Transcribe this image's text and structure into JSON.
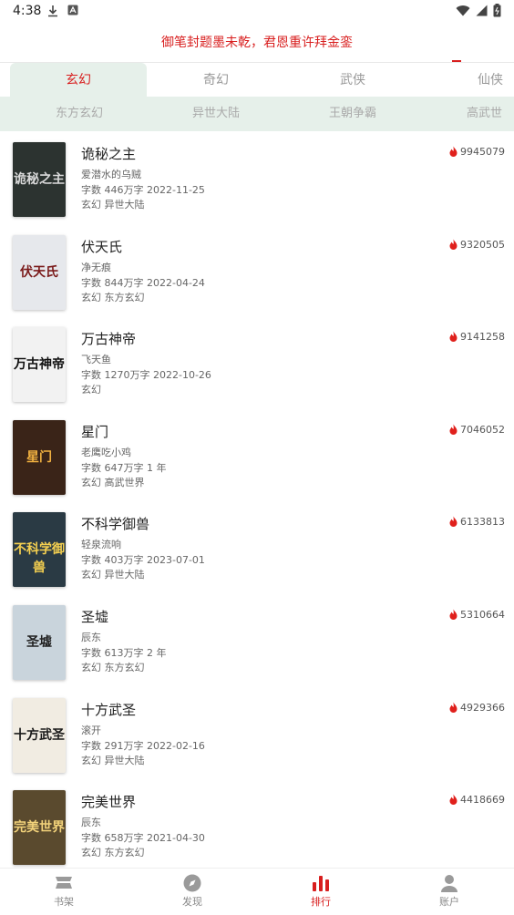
{
  "status_bar": {
    "time": "4:38"
  },
  "header": {
    "slogan": "御笔封题墨未乾，君恩重许拜金銮"
  },
  "tabs": [
    {
      "label": "玄幻",
      "active": true
    },
    {
      "label": "奇幻",
      "active": false
    },
    {
      "label": "武侠",
      "active": false
    },
    {
      "label": "仙侠",
      "active": false
    }
  ],
  "subtabs": [
    {
      "label": "东方玄幻"
    },
    {
      "label": "异世大陆"
    },
    {
      "label": "王朝争霸"
    },
    {
      "label": "高武世"
    }
  ],
  "books": [
    {
      "title": "诡秘之主",
      "author": "爱潜水的乌贼",
      "stats": "字数 446万字  2022-11-25",
      "tags": "玄幻 异世大陆",
      "heat": "9945079",
      "cover_text": "诡秘之主",
      "cover_bg": "#2c3330",
      "cover_fg": "#d9d9d9"
    },
    {
      "title": "伏天氏",
      "author": "净无痕",
      "stats": "字数 844万字  2022-04-24",
      "tags": "玄幻 东方玄幻",
      "heat": "9320505",
      "cover_text": "伏天氏",
      "cover_bg": "#e6e8ec",
      "cover_fg": "#7a1a1a"
    },
    {
      "title": "万古神帝",
      "author": "飞天鱼",
      "stats": "字数 1270万字  2022-10-26",
      "tags": "玄幻",
      "heat": "9141258",
      "cover_text": "万古神帝",
      "cover_bg": "#f2f2f2",
      "cover_fg": "#111111"
    },
    {
      "title": "星门",
      "author": "老鹰吃小鸡",
      "stats": "字数 647万字  1 年",
      "tags": "玄幻 高武世界",
      "heat": "7046052",
      "cover_text": "星门",
      "cover_bg": "#3a2418",
      "cover_fg": "#f0b040"
    },
    {
      "title": "不科学御兽",
      "author": "轻泉流响",
      "stats": "字数 403万字  2023-07-01",
      "tags": "玄幻 异世大陆",
      "heat": "6133813",
      "cover_text": "不科学御兽",
      "cover_bg": "#2a3a44",
      "cover_fg": "#f5d050"
    },
    {
      "title": "圣墟",
      "author": "辰东",
      "stats": "字数 613万字  2 年",
      "tags": "玄幻 东方玄幻",
      "heat": "5310664",
      "cover_text": "圣墟",
      "cover_bg": "#c9d4dc",
      "cover_fg": "#222222"
    },
    {
      "title": "十方武圣",
      "author": "滚开",
      "stats": "字数 291万字  2022-02-16",
      "tags": "玄幻 异世大陆",
      "heat": "4929366",
      "cover_text": "十方武圣",
      "cover_bg": "#f1ece2",
      "cover_fg": "#1a1a1a"
    },
    {
      "title": "完美世界",
      "author": "辰东",
      "stats": "字数 658万字  2021-04-30",
      "tags": "玄幻 东方玄幻",
      "heat": "4418669",
      "cover_text": "完美世界",
      "cover_bg": "#5a4a2e",
      "cover_fg": "#f2d27a"
    }
  ],
  "bottom_nav": [
    {
      "label": "书架",
      "icon": "bookshelf-icon",
      "active": false
    },
    {
      "label": "发现",
      "icon": "compass-icon",
      "active": false
    },
    {
      "label": "排行",
      "icon": "ranking-icon",
      "active": true
    },
    {
      "label": "账户",
      "icon": "account-icon",
      "active": false
    }
  ],
  "colors": {
    "accent": "#d81e1e",
    "tab_bg": "#e6f0ea",
    "flame": "#e0201c"
  }
}
